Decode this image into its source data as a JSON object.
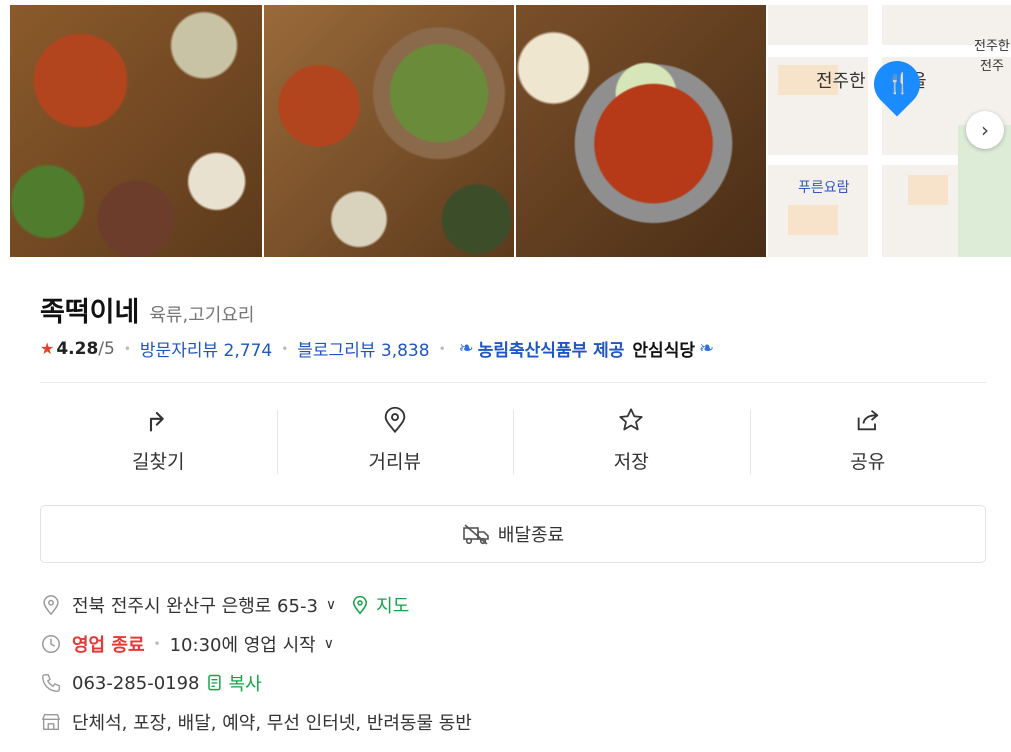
{
  "gallery": {
    "map_labels": [
      "전주한",
      "을",
      "전주한",
      "전주",
      "푸른요람"
    ],
    "next_icon": "chevron-right-icon"
  },
  "place": {
    "name": "족떡이네",
    "category": "육류,고기요리",
    "rating": "4.28",
    "rating_suffix": "/5",
    "visitor_review_label": "방문자리뷰",
    "visitor_review_count": "2,774",
    "blog_review_label": "블로그리뷰",
    "blog_review_count": "3,838",
    "cert_provider": "농림축산식품부 제공",
    "cert_badge": "안심식당"
  },
  "actions": [
    {
      "label": "길찾기",
      "icon": "directions-icon"
    },
    {
      "label": "거리뷰",
      "icon": "location-pin-icon"
    },
    {
      "label": "저장",
      "icon": "star-icon"
    },
    {
      "label": "공유",
      "icon": "share-icon"
    }
  ],
  "delivery": {
    "label": "배달종료",
    "icon": "delivery-truck-icon"
  },
  "details": {
    "address": "전북 전주시 완산구 은행로 65-3",
    "map_link": "지도",
    "status": "영업 종료",
    "hours": "10:30에 영업 시작",
    "phone": "063-285-0198",
    "copy_link": "복사",
    "amenities": "단체석, 포장, 배달, 예약, 무선 인터넷, 반려동물 동반"
  },
  "colors": {
    "accent_blue": "#1f56c4",
    "closed_red": "#e53935",
    "link_green": "#16a34a",
    "pin_blue": "#1a8cff"
  }
}
